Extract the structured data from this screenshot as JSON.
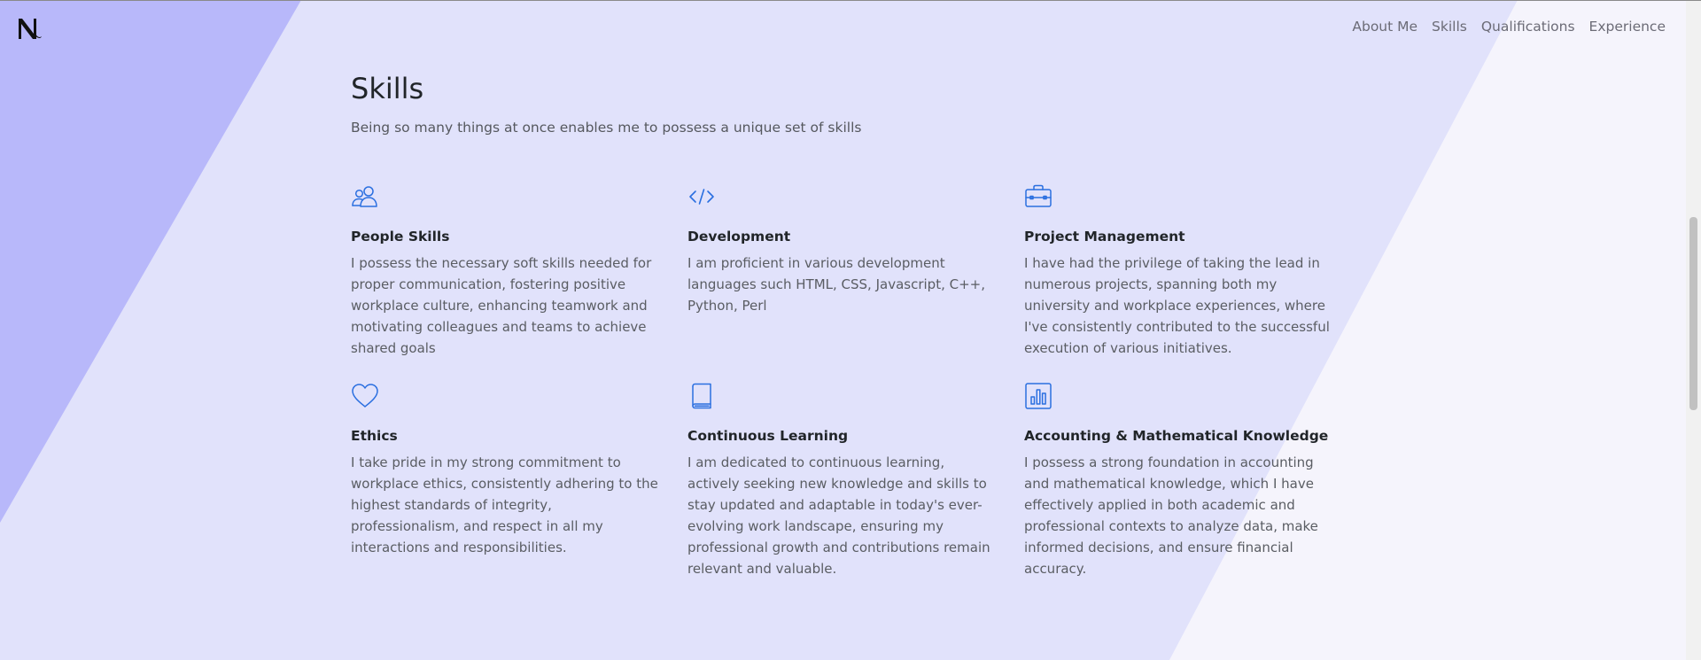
{
  "header": {
    "logo_alt": "N logo",
    "nav": [
      {
        "label": "About Me"
      },
      {
        "label": "Skills"
      },
      {
        "label": "Qualifications"
      },
      {
        "label": "Experience"
      }
    ]
  },
  "skills": {
    "title": "Skills",
    "subtitle": "Being so many things at once enables me to possess a unique set of skills",
    "items": [
      {
        "icon": "people-icon",
        "title": "People Skills",
        "text": "I possess the necessary soft skills needed for proper communication, fostering positive workplace culture, enhancing teamwork and motivating colleagues and teams to achieve shared goals"
      },
      {
        "icon": "code-icon",
        "title": "Development",
        "text": "I am proficient in various development languages such HTML, CSS, Javascript, C++, Python, Perl"
      },
      {
        "icon": "briefcase-icon",
        "title": "Project Management",
        "text": "I have had the privilege of taking the lead in numerous projects, spanning both my university and workplace experiences, where I've consistently contributed to the successful execution of various initiatives."
      },
      {
        "icon": "heart-icon",
        "title": "Ethics",
        "text": "I take pride in my strong commitment to workplace ethics, consistently adhering to the highest standards of integrity, professionalism, and respect in all my interactions and responsibilities."
      },
      {
        "icon": "book-icon",
        "title": "Continuous Learning",
        "text": "I am dedicated to continuous learning, actively seeking new knowledge and skills to stay updated and adaptable in today's ever-evolving work landscape, ensuring my professional growth and contributions remain relevant and valuable."
      },
      {
        "icon": "bar-chart-icon",
        "title": "Accounting & Mathematical Knowledge",
        "text": "I possess a strong foundation in accounting and mathematical knowledge, which I have effectively applied in both academic and professional contexts to analyze data, make informed decisions, and ensure financial accuracy."
      }
    ]
  },
  "colors": {
    "background": "#e1e2fb",
    "left_stripe": "#b8b8fa",
    "right_panel": "#f5f4fc",
    "icon_accent": "#2a6fe0",
    "heading": "#212529",
    "body_text": "#5a5d63"
  }
}
